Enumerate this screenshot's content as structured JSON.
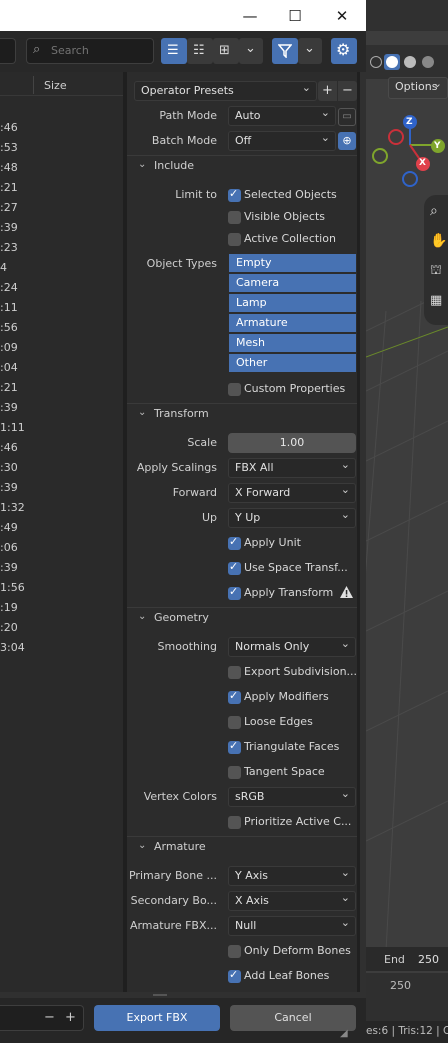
{
  "window": {
    "minimize": "—",
    "maximize": "☐",
    "close": "✕"
  },
  "toolbar": {
    "search_placeholder": "Search"
  },
  "filelist": {
    "size_header": "Size",
    "times": [
      ":46",
      ":53",
      ":48",
      ":21",
      ":27",
      ":39",
      ":23",
      "4",
      ":24",
      ":11",
      ":56",
      ":09",
      ":04",
      ":21",
      ":39",
      "1:11",
      ":46",
      ":30",
      ":39",
      "1:32",
      ":49",
      ":06",
      ":39",
      "1:56",
      ":19",
      ":20",
      "3:04"
    ]
  },
  "presets": {
    "label": "Operator Presets",
    "add": "+",
    "remove": "−"
  },
  "path_mode": {
    "label": "Path Mode",
    "value": "Auto"
  },
  "batch_mode": {
    "label": "Batch Mode",
    "value": "Off"
  },
  "include": {
    "title": "Include",
    "limit_to_label": "Limit to",
    "selected_objects": "Selected Objects",
    "visible_objects": "Visible Objects",
    "active_collection": "Active Collection",
    "object_types_label": "Object Types",
    "object_types": [
      "Empty",
      "Camera",
      "Lamp",
      "Armature",
      "Mesh",
      "Other"
    ],
    "custom_properties": "Custom Properties"
  },
  "transform": {
    "title": "Transform",
    "scale_label": "Scale",
    "scale_value": "1.00",
    "apply_scalings_label": "Apply Scalings",
    "apply_scalings_value": "FBX All",
    "forward_label": "Forward",
    "forward_value": "X Forward",
    "up_label": "Up",
    "up_value": "Y Up",
    "apply_unit": "Apply Unit",
    "use_space_transform": "Use Space Transf...",
    "apply_transform": "Apply Transform"
  },
  "geometry": {
    "title": "Geometry",
    "smoothing_label": "Smoothing",
    "smoothing_value": "Normals Only",
    "export_subdivision": "Export Subdivision...",
    "apply_modifiers": "Apply Modifiers",
    "loose_edges": "Loose Edges",
    "triangulate_faces": "Triangulate Faces",
    "tangent_space": "Tangent Space",
    "vertex_colors_label": "Vertex Colors",
    "vertex_colors_value": "sRGB",
    "prioritize_active": "Prioritize Active C..."
  },
  "armature": {
    "title": "Armature",
    "primary_bone_label": "Primary Bone ...",
    "primary_bone_value": "Y Axis",
    "secondary_bone_label": "Secondary Bo...",
    "secondary_bone_value": "X Axis",
    "armature_fbx_label": "Armature FBX...",
    "armature_fbx_value": "Null",
    "only_deform_bones": "Only Deform Bones",
    "add_leaf_bones": "Add Leaf Bones"
  },
  "bottom": {
    "minus": "−",
    "plus": "+",
    "export_label": "Export FBX",
    "cancel_label": "Cancel"
  },
  "viewport": {
    "options_label": "Options",
    "gizmo_z": "Z",
    "gizmo_y": "Y",
    "gizmo_x": "X",
    "end_label": "End",
    "end_value": "250",
    "frame_250": "250",
    "stats": "es:6 | Tris:12 | O"
  },
  "colors": {
    "accent": "#4772b3",
    "panel": "#2c2c2c"
  }
}
